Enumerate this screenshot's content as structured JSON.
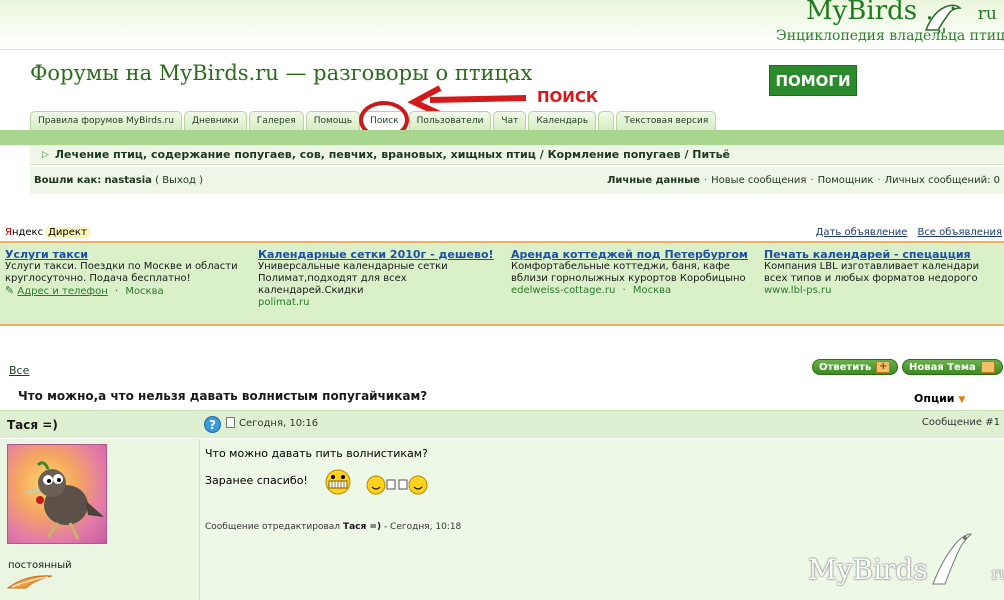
{
  "header": {
    "logo_text": "MyBirds .",
    "logo_ru": "ru",
    "logo_subtitle": "Энциклопедия владельца птицы",
    "forum_title": "Форумы на MyBirds.ru — разговоры о птицах",
    "help_button": "ПОМОГИ"
  },
  "annotation": {
    "label": "ПОИСК",
    "color": "#d31b1b"
  },
  "tabs": [
    {
      "label": "Правила форумов MyBirds.ru"
    },
    {
      "label": "Дневники"
    },
    {
      "label": "Галерея"
    },
    {
      "label": "Помощь"
    },
    {
      "label": "Поиск"
    },
    {
      "label": "Пользователи"
    },
    {
      "label": "Чат"
    },
    {
      "label": "Календарь"
    },
    {
      "label": ""
    },
    {
      "label": "Текстовая версия"
    }
  ],
  "breadcrumb": {
    "text": "Лечение птиц, содержание попугаев, сов, певчих, врановых, хищных птиц / Кормление попугаев / Питьё"
  },
  "userbar": {
    "logged_in_label": "Вошли как:",
    "username": "nastasia",
    "logout": "( Выход )",
    "links": [
      "Личные данные",
      "Новые сообщения",
      "Помощник",
      "Личных сообщений: 0"
    ]
  },
  "ads": {
    "yandex_y": "Я",
    "yandex_rest": "ндекс",
    "direkt": "Директ",
    "post_ad": "Дать объявление",
    "all_ads": "Все объявления",
    "items": [
      {
        "title": "Услуги такси",
        "text": "Услуги такси. Поездки по Москве и области круглосуточно. Подача бесплатно!",
        "url": "Адрес и телефон",
        "loc": "Москва"
      },
      {
        "title": "Календарные сетки 2010г - дешево!",
        "text": "Универсальные календарные сетки Полимат,подходят для всех календарей.Скидки",
        "url": "polimat.ru",
        "loc": ""
      },
      {
        "title": "Аренда коттеджей под Петербургом",
        "text": "Комфортабельные коттеджи, баня, кафе вблизи горнолыжных курортов Коробицыно",
        "url": "edelweiss-cottage.ru",
        "loc": "Москва"
      },
      {
        "title": "Печать календарей - спецацция",
        "text": "Компания LBL изготавливает календари всех типов и любых форматов недорого",
        "url": "www.lbl-ps.ru",
        "loc": ""
      }
    ]
  },
  "thread": {
    "all_link": "Все",
    "reply_button": "Ответить",
    "new_topic_button": "Новая Тема",
    "title": "Что можно,а что нельзя давать волнистым попугайчикам?",
    "options": "Опции"
  },
  "post": {
    "author": "Тася =)",
    "date": "Сегодня, 10:16",
    "number": "Сообщение #1",
    "rank": "постоянный",
    "line1": "Что можно давать пить волнистикам?",
    "line2": "Заранее спасибо!",
    "edit_prefix": "Сообщение отредактировал",
    "edit_author": "Тася =)",
    "edit_suffix": "- Сегодня, 10:18"
  },
  "watermark": {
    "text": "MyBirds .",
    "ru": "ru"
  },
  "colors": {
    "accent_green": "#2b8a2b",
    "tab_bar": "#a9d68f",
    "annotation_red": "#d31b1b"
  }
}
